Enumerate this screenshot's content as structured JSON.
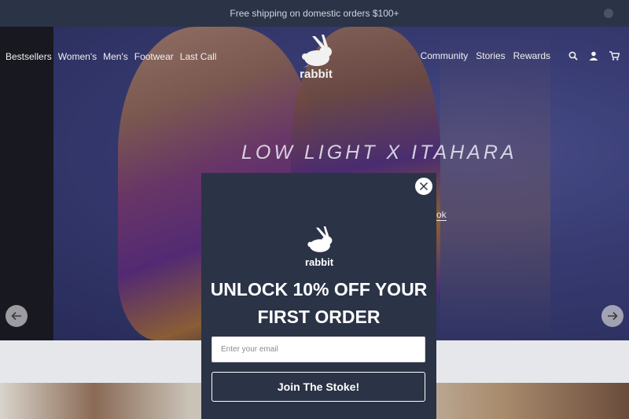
{
  "announcement": {
    "text": "Free shipping on domestic orders $100+"
  },
  "nav": {
    "left": [
      {
        "label": "Bestsellers"
      },
      {
        "label": "Women's"
      },
      {
        "label": "Men's"
      },
      {
        "label": "Footwear"
      },
      {
        "label": "Last Call"
      }
    ],
    "right": [
      {
        "label": "Community"
      },
      {
        "label": "Stories"
      },
      {
        "label": "Rewards"
      }
    ],
    "icons": [
      "search-icon",
      "account-icon",
      "cart-icon"
    ]
  },
  "brand": {
    "logo_text": "rabbit"
  },
  "hero": {
    "title": "LOW LIGHT X ITAHARA",
    "link_text": "ok"
  },
  "popup": {
    "logo_text": "rabbit",
    "headline_line1": "UNLOCK 10% OFF YOUR",
    "headline_line2": "FIRST ORDER",
    "email_placeholder": "Enter your email",
    "button_label": "Join The Stoke!"
  },
  "colors": {
    "navy": "#2b3346",
    "announcement_bg": "#2b3346",
    "white": "#ffffff"
  }
}
